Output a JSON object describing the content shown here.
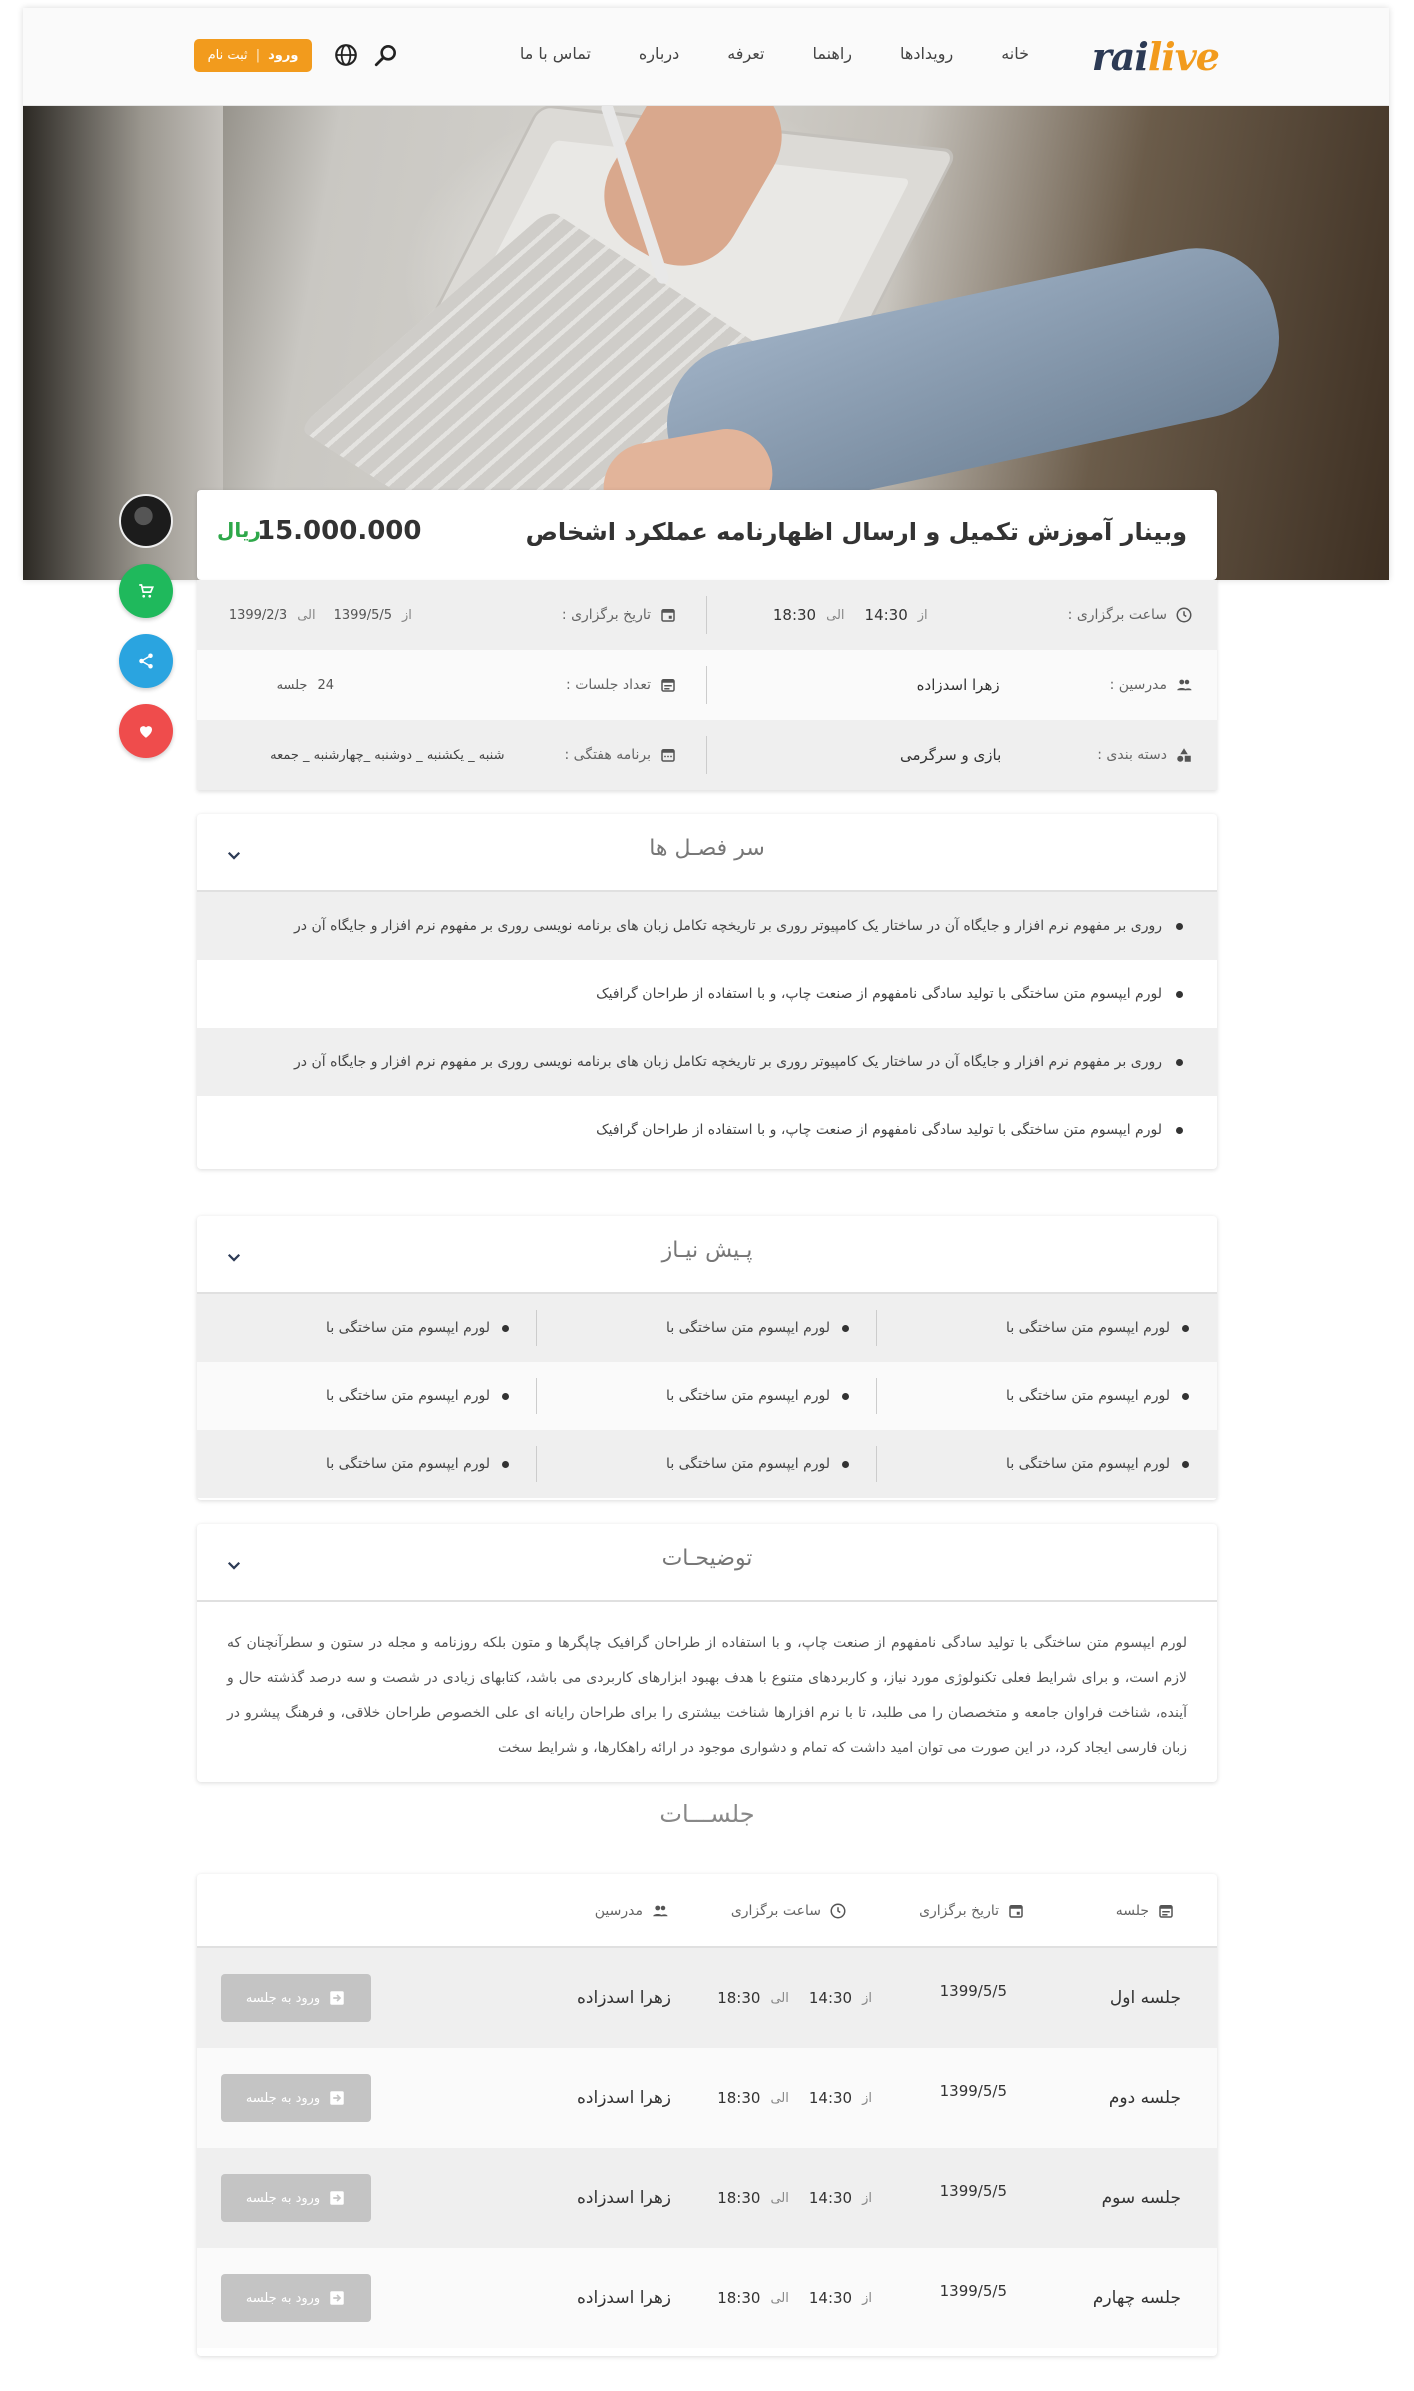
{
  "header": {
    "logo_part1": "rai",
    "logo_part2": "live",
    "nav": [
      "خانه",
      "رویدادها",
      "راهنما",
      "تعرفه",
      "درباره",
      "تماس با ما"
    ],
    "login_label": "ورود",
    "register_label": "ثبت نام",
    "search_icon": "search-icon",
    "language_icon": "globe-icon"
  },
  "event": {
    "title": "وبینار آموزش تکمیل و ارسال اظهارنامه عملکرد اشخاص",
    "price": "15.000.000",
    "currency_symbol": "ریال"
  },
  "info": {
    "time_label": "ساعت برگزاری :",
    "time_from_word": "از",
    "time_from": "14:30",
    "time_to_word": "الی",
    "time_to": "18:30",
    "date_label": "تاریخ برگزاری :",
    "date_from_word": "از",
    "date_from": "1399/5/5",
    "date_to_word": "الی",
    "date_to": "1399/2/3",
    "teachers_label": "مدرسین :",
    "teacher_name": "زهرا اسدزاده",
    "sessions_count_label": "تعداد جلسات :",
    "sessions_count": "24",
    "sessions_unit": "جلسه",
    "category_label": "دسته بندی :",
    "category": "بازی و سرگرمی",
    "weekly_label": "برنامه هفتگی :",
    "weekly": "شنبه _ یکشنبه _ دوشنبه _چهارشنبه _ جمعه"
  },
  "side_buttons": {
    "cart_color": "#1fb95c",
    "share_color": "#2aa4e0",
    "like_color": "#ef4c4c"
  },
  "topics": {
    "title": "سر فصـل ها",
    "items": [
      "روری بر مفهوم نرم افزار و جایگاه آن در ساختار یک کامپیوتر روری بر تاریخچه تکامل زبان های برنامه نویسی روری بر مفهوم نرم افزار و جایگاه آن در",
      "لورم ایپسوم متن ساختگی با تولید سادگی نامفهوم از صنعت چاپ، و با استفاده از طراحان گرافیک",
      "روری بر مفهوم نرم افزار و جایگاه آن در ساختار یک کامپیوتر روری بر تاریخچه تکامل زبان های برنامه نویسی روری بر مفهوم نرم افزار و جایگاه آن در",
      "لورم ایپسوم متن ساختگی با تولید سادگی نامفهوم از صنعت چاپ، و با استفاده از طراحان گرافیک"
    ]
  },
  "prereq": {
    "title": "پـیش نیـاز",
    "rows": [
      [
        "لورم ایپسوم متن ساختگی با",
        "لورم ایپسوم متن ساختگی با",
        "لورم ایپسوم متن ساختگی با"
      ],
      [
        "لورم ایپسوم متن ساختگی با",
        "لورم ایپسوم متن ساختگی با",
        "لورم ایپسوم متن ساختگی با"
      ],
      [
        "لورم ایپسوم متن ساختگی با",
        "لورم ایپسوم متن ساختگی با",
        "لورم ایپسوم متن ساختگی با"
      ]
    ]
  },
  "description": {
    "title": "توضیحـات",
    "text": "لورم ایپسوم متن ساختگی با تولید سادگی نامفهوم از صنعت چاپ، و با استفاده از طراحان گرافیک چاپگرها و متون بلکه روزنامه و مجله در ستون و سطرآنچنان که لازم است، و برای شرایط فعلی تکنولوژی مورد نیاز، و کاربردهای متنوع با هدف بهبود ابزارهای کاربردی می باشد، کتابهای زیادی در شصت و سه درصد گذشته حال و آینده، شناخت فراوان جامعه و متخصصان را می طلبد، تا با نرم افزارها شناخت بیشتری را برای طراحان رایانه ای علی الخصوص طراحان خلاقی، و فرهنگ پیشرو در زبان فارسی ایجاد کرد، در این صورت می توان امید داشت که تمام و دشواری موجود در ارائه راهکارها، و شرایط سخت"
  },
  "sessions": {
    "title": "جلســـات",
    "headers": {
      "session": "جلسه",
      "date": "تاریخ برگزاری",
      "time": "ساعت برگزاری",
      "teachers": "مدرسین"
    },
    "rows": [
      {
        "name": "جلسه اول",
        "date": "1399/5/5",
        "from_word": "از",
        "from": "14:30",
        "to_word": "الی",
        "to": "18:30",
        "teacher": "زهرا اسدزاده",
        "button": "ورود به جلسه"
      },
      {
        "name": "جلسه دوم",
        "date": "1399/5/5",
        "from_word": "از",
        "from": "14:30",
        "to_word": "الی",
        "to": "18:30",
        "teacher": "زهرا اسدزاده",
        "button": "ورود به جلسه"
      },
      {
        "name": "جلسه سوم",
        "date": "1399/5/5",
        "from_word": "از",
        "from": "14:30",
        "to_word": "الی",
        "to": "18:30",
        "teacher": "زهرا اسدزاده",
        "button": "ورود به جلسه"
      },
      {
        "name": "جلسه چهارم",
        "date": "1399/5/5",
        "from_word": "از",
        "from": "14:30",
        "to_word": "الی",
        "to": "18:30",
        "teacher": "زهرا اسدزاده",
        "button": "ورود به جلسه"
      }
    ]
  }
}
